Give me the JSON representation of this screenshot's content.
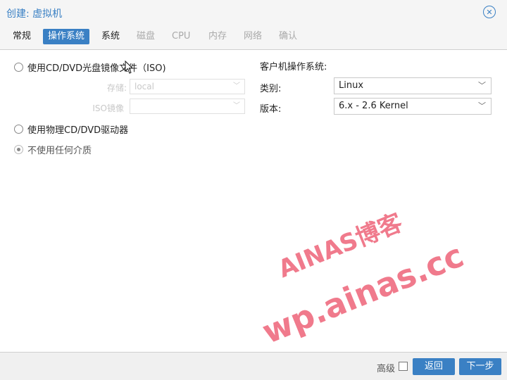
{
  "dialog": {
    "title": "创建: 虚拟机"
  },
  "tabs": [
    {
      "label": "常规",
      "state": "normal"
    },
    {
      "label": "操作系统",
      "state": "active"
    },
    {
      "label": "系统",
      "state": "normal"
    },
    {
      "label": "磁盘",
      "state": "disabled"
    },
    {
      "label": "CPU",
      "state": "disabled"
    },
    {
      "label": "内存",
      "state": "disabled"
    },
    {
      "label": "网络",
      "state": "disabled"
    },
    {
      "label": "确认",
      "state": "disabled"
    }
  ],
  "media": {
    "options": [
      {
        "label": "使用CD/DVD光盘镜像文件（ISO)",
        "selected": false
      },
      {
        "label": "使用物理CD/DVD驱动器",
        "selected": false
      },
      {
        "label": "不使用任何介质",
        "selected": true
      }
    ],
    "storage_label": "存储:",
    "storage_value": "local",
    "iso_label": "ISO镜像",
    "iso_value": ""
  },
  "guest_os": {
    "section_title": "客户机操作系统:",
    "type_label": "类别:",
    "type_value": "Linux",
    "version_label": "版本:",
    "version_value": "6.x - 2.6 Kernel"
  },
  "footer": {
    "advanced_label": "高级",
    "advanced_checked": false,
    "back_label": "返回",
    "next_label": "下一步"
  },
  "watermark": {
    "line1": "AINAS博客",
    "line2": "wp.ainas.cc"
  },
  "colors": {
    "accent": "#3a80c4",
    "watermark": "#f07a8c"
  },
  "icons": {
    "close": "close-circle-icon",
    "dropdown": "chevron-down-icon",
    "cursor": "mouse-cursor-icon"
  }
}
